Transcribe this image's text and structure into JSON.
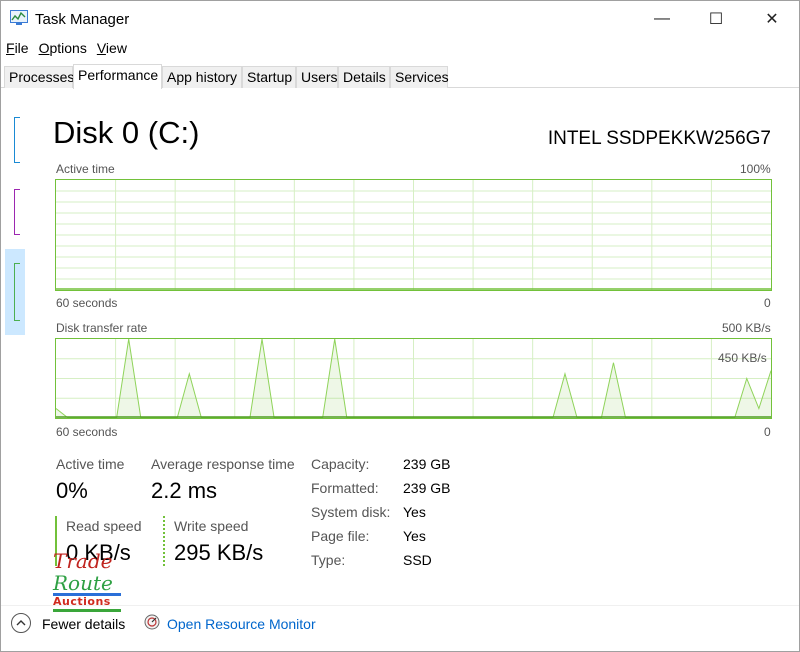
{
  "window": {
    "title": "Task Manager",
    "controls": {
      "minimize": "—",
      "maximize": "☐",
      "close": "✕"
    }
  },
  "menu": [
    {
      "underline": "F",
      "rest": "ile"
    },
    {
      "underline": "O",
      "rest": "ptions"
    },
    {
      "underline": "V",
      "rest": "iew"
    }
  ],
  "tabs": [
    "Processes",
    "Performance",
    "App history",
    "Startup",
    "Users",
    "Details",
    "Services"
  ],
  "active_tab": "Performance",
  "disk": {
    "title": "Disk 0 (C:)",
    "model": "INTEL SSDPEKKW256G7"
  },
  "active_graph": {
    "label": "Active time",
    "max_label": "100%",
    "time_label": "60 seconds",
    "min_label": "0",
    "color": "#72c13a"
  },
  "transfer_graph": {
    "label": "Disk transfer rate",
    "max_label": "500 KB/s",
    "inner_label": "450 KB/s",
    "time_label": "60 seconds",
    "min_label": "0",
    "read_series": [
      0,
      0,
      0,
      0,
      0,
      0,
      0,
      0,
      0,
      0,
      0,
      0,
      0,
      0,
      0,
      0,
      0,
      0,
      0,
      0,
      0,
      0,
      0,
      0,
      0,
      0,
      0,
      0,
      0,
      0,
      0,
      0,
      0,
      0,
      0,
      0,
      0,
      0,
      0,
      0,
      0,
      0,
      0,
      0,
      0,
      0,
      0,
      0,
      0,
      0,
      0,
      0,
      0,
      0,
      0,
      0,
      0,
      0,
      0,
      0
    ],
    "write_series": [
      60,
      0,
      0,
      0,
      0,
      0,
      500,
      0,
      0,
      0,
      0,
      280,
      0,
      0,
      0,
      0,
      0,
      500,
      0,
      0,
      0,
      0,
      0,
      500,
      0,
      0,
      0,
      0,
      0,
      0,
      0,
      0,
      0,
      0,
      0,
      0,
      0,
      0,
      0,
      0,
      0,
      0,
      280,
      0,
      0,
      0,
      350,
      0,
      0,
      0,
      0,
      0,
      0,
      0,
      0,
      0,
      0,
      250,
      60,
      300
    ]
  },
  "stats": {
    "active_time_label": "Active time",
    "active_time_value": "0%",
    "avg_response_label": "Average response time",
    "avg_response_value": "2.2 ms",
    "read_speed_label": "Read speed",
    "read_speed_value": "0 KB/s",
    "write_speed_label": "Write speed",
    "write_speed_value": "295 KB/s"
  },
  "info": [
    {
      "label": "Capacity:",
      "value": "239 GB"
    },
    {
      "label": "Formatted:",
      "value": "239 GB"
    },
    {
      "label": "System disk:",
      "value": "Yes"
    },
    {
      "label": "Page file:",
      "value": "Yes"
    },
    {
      "label": "Type:",
      "value": "SSD"
    }
  ],
  "footer": {
    "fewer_details": "Fewer details",
    "resource_monitor": "Open Resource Monitor"
  },
  "watermark": {
    "line1": "Trade",
    "line2": "Route",
    "line3": "Auctions"
  }
}
